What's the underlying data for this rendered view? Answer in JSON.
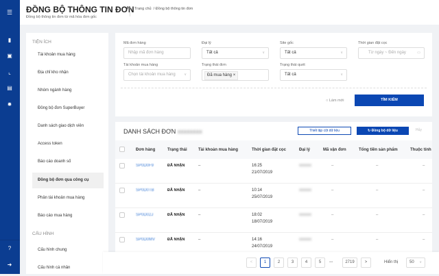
{
  "header": {
    "title": "ĐỒNG BỘ THÔNG TIN ĐƠN",
    "subtitle": "Đồng bộ thông tin đơn từ mã hóa đơn gốc",
    "breadcrumb_home": "Trang chủ",
    "breadcrumb_current": "/ Đồng bộ thông tin đơn"
  },
  "sidebar": {
    "section1": "TIỆN ÍCH",
    "items": [
      "Tài khoản mua hàng",
      "Địa chỉ kho nhận",
      "Nhóm ngành hàng",
      "Đồng bộ đơn SuperBuyer",
      "Danh sách giao dịch viên",
      "Access token",
      "Báo cáo doanh số",
      "Đồng bộ đơn qua công cụ",
      "Phân tài khoản mua hàng",
      "Báo cáo mua hàng"
    ],
    "section2": "CẤU HÌNH",
    "config_items": [
      "Cấu hình chung",
      "Cấu hình cá nhân"
    ]
  },
  "filters": {
    "order_code": {
      "label": "Mã đơn hàng",
      "placeholder": "Nhập mã đơn hàng"
    },
    "agent": {
      "label": "Đại lý",
      "value": "Tất cả"
    },
    "site": {
      "label": "Site gốc",
      "value": "Tất cả"
    },
    "deposit_time": {
      "label": "Thời gian đặt cọc",
      "from": "Từ ngày",
      "sep": "~",
      "to": "Đến ngày"
    },
    "account": {
      "label": "Tài khoản mua hàng",
      "placeholder": "Chọn tài khoản mua hàng"
    },
    "order_status": {
      "label": "Trạng thái đơn",
      "tag": "Đã mua hàng"
    },
    "scan_status": {
      "label": "Trạng thái quét",
      "value": "Tất cả"
    },
    "reset": "Làm mới",
    "search": "TÌM KIẾM"
  },
  "list": {
    "title": "DANH SÁCH ĐƠN",
    "title_blurred": "xxxxxxxx",
    "setup_columns": "Thiết lập cột dữ liệu",
    "sync": "Đồng bộ dữ liệu",
    "cancel": "Hủy",
    "columns": [
      "Đơn hàng",
      "Trạng thái",
      "Tài khoản mua hàng",
      "Thời gian đặt cọc",
      "Đại lý",
      "Mã vận đơn",
      "Tổng tiền sản phẩm",
      "Thuộc tính"
    ],
    "rows": [
      {
        "order": "SP0D0F9",
        "status": "ĐÃ NHẬN",
        "account": "–",
        "time": "16:25",
        "date": "21/07/2019",
        "agent": "xxxxxx",
        "tracking": "–",
        "total": "–",
        "attr": "–"
      },
      {
        "order": "SP0D0TB",
        "status": "ĐÃ NHẬN",
        "account": "–",
        "time": "10:14",
        "date": "25/07/2019",
        "agent": "xxxxxx",
        "tracking": "–",
        "total": "–",
        "attr": "–"
      },
      {
        "order": "SP0D02J",
        "status": "ĐÃ NHẬN",
        "account": "–",
        "time": "18:02",
        "date": "18/07/2019",
        "agent": "xxxxxx",
        "tracking": "–",
        "total": "–",
        "attr": "–"
      },
      {
        "order": "SP0D0MV",
        "status": "ĐÃ NHẬN",
        "account": "–",
        "time": "14:16",
        "date": "24/07/2019",
        "agent": "xxxxxx",
        "tracking": "–",
        "total": "–",
        "attr": "–"
      }
    ]
  },
  "pagination": {
    "prev": "<",
    "pages": [
      "1",
      "2",
      "3",
      "4",
      "5"
    ],
    "ellipsis": "•••",
    "last": "2719",
    "next": ">",
    "show_label": "Hiển thị",
    "page_size": "50",
    "current": "1"
  }
}
